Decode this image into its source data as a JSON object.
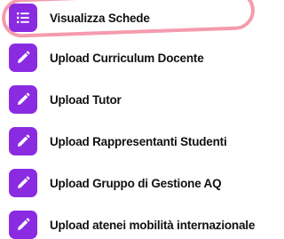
{
  "menu": {
    "items": [
      {
        "label": "Visualizza Schede",
        "icon": "list-icon"
      },
      {
        "label": "Upload Curriculum Docente",
        "icon": "pencil-icon"
      },
      {
        "label": "Upload Tutor",
        "icon": "pencil-icon"
      },
      {
        "label": "Upload Rappresentanti Studenti",
        "icon": "pencil-icon"
      },
      {
        "label": "Upload Gruppo di Gestione AQ",
        "icon": "pencil-icon"
      },
      {
        "label": "Upload atenei mobilità internazionale",
        "icon": "pencil-icon"
      }
    ]
  },
  "colors": {
    "icon_background": "#8a2be2",
    "highlight": "#f1708c",
    "text": "#111111"
  }
}
